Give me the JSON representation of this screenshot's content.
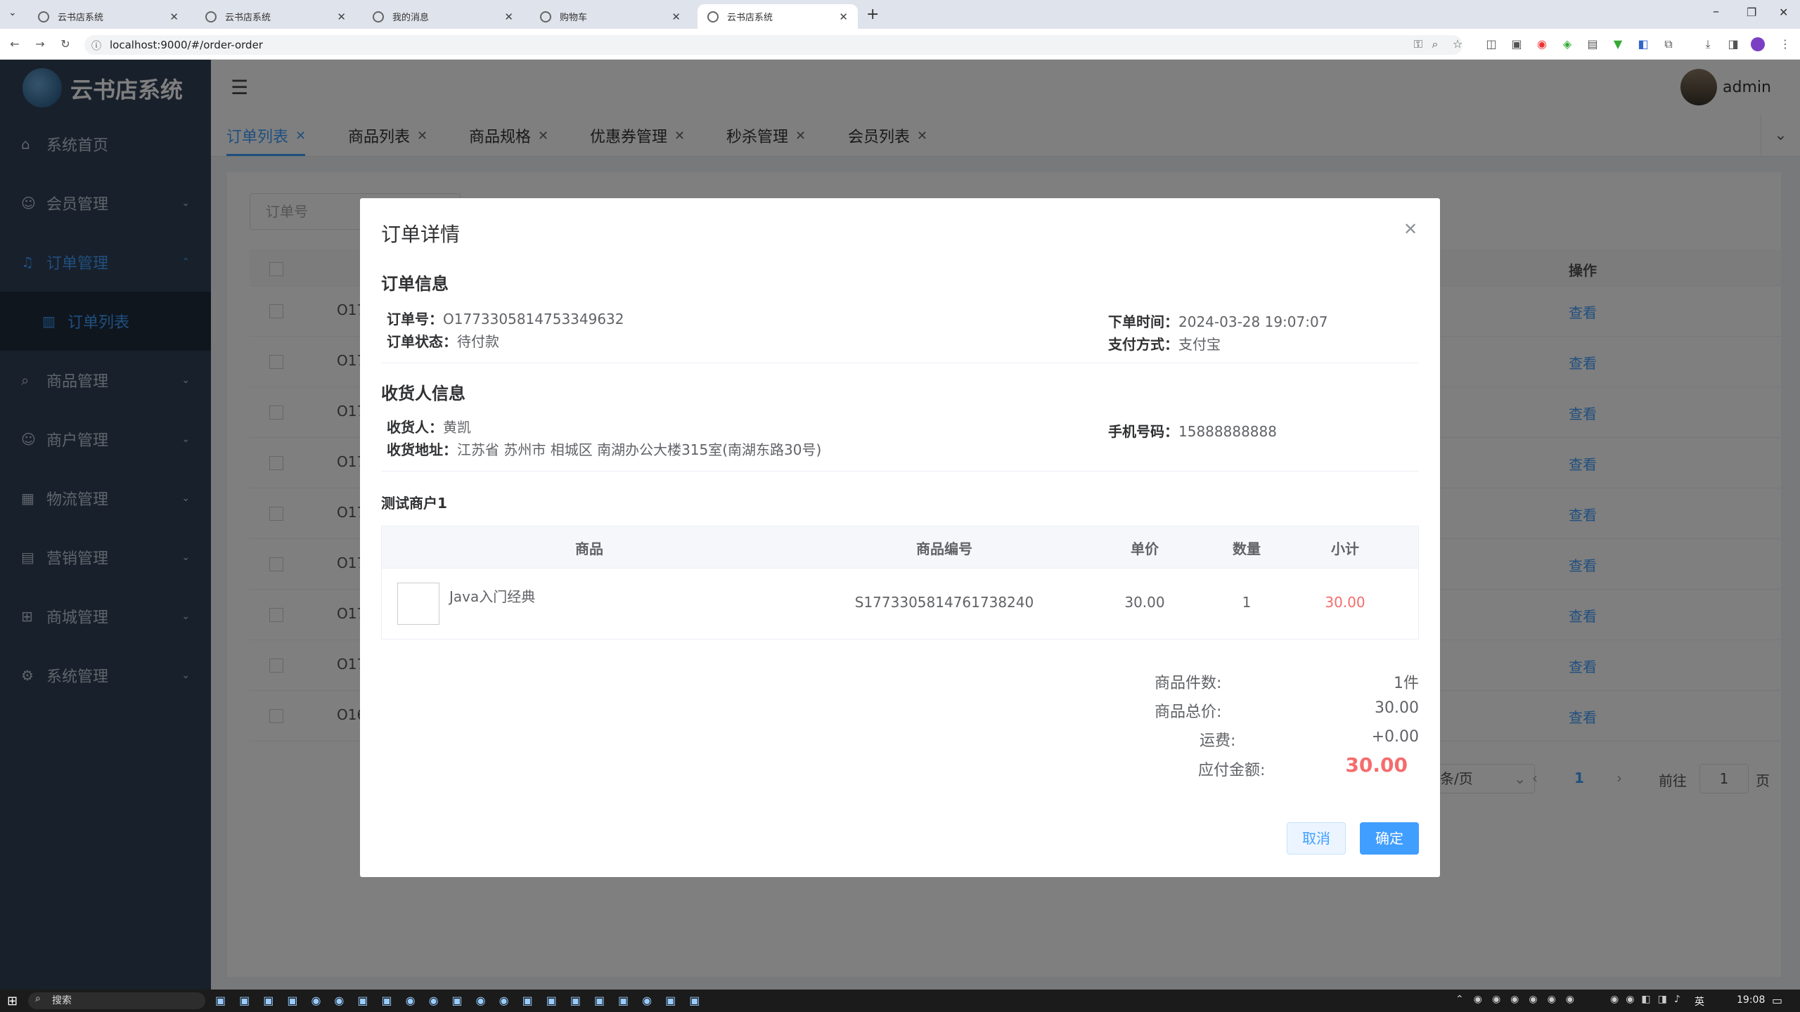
{
  "browser": {
    "tabs": [
      "云书店系统",
      "云书店系统",
      "我的消息",
      "购物车",
      "云书店系统"
    ],
    "url": "localhost:9000/#/order-order"
  },
  "app": {
    "logo": "云书店系统",
    "user": "admin",
    "menu": [
      "系统首页",
      "会员管理",
      "订单管理",
      "订单列表",
      "商品管理",
      "商户管理",
      "物流管理",
      "营销管理",
      "商城管理",
      "系统管理"
    ],
    "page_tabs": [
      "订单列表",
      "商品列表",
      "商品规格",
      "优惠券管理",
      "秒杀管理",
      "会员列表"
    ],
    "filter_placeholder": "订单号",
    "op_header": "操作",
    "row_prefixes": [
      "O17",
      "O17",
      "O17",
      "O17",
      "O17",
      "O17",
      "O17",
      "O17",
      "O16"
    ],
    "view_label": "查看",
    "pagination": {
      "size": "条/页",
      "page": "1",
      "goto": "前往",
      "goto_value": "1",
      "unit": "页"
    }
  },
  "dialog": {
    "title": "订单详情",
    "order_section": "订单信息",
    "order_no_label": "订单号：",
    "order_no": "O1773305814753349632",
    "order_time_label": "下单时间：",
    "order_time": "2024-03-28 19:07:07",
    "status_label": "订单状态：",
    "status": "待付款",
    "pay_label": "支付方式：",
    "pay": "支付宝",
    "receiver_section": "收货人信息",
    "receiver_label": "收货人：",
    "receiver": "黄凯",
    "phone_label": "手机号码：",
    "phone": "15888888888",
    "address_label": "收货地址：",
    "address": "江苏省 苏州市 相城区 南湖办公大楼315室(南湖东路30号)",
    "merchant": "测试商户1",
    "table_headers": [
      "商品",
      "商品编号",
      "单价",
      "数量",
      "小计"
    ],
    "item": {
      "name": "Java入门经典",
      "code": "S1773305814761738240",
      "price": "30.00",
      "qty": "1",
      "subtotal": "30.00"
    },
    "summary": [
      {
        "label": "商品件数:",
        "value": "1件"
      },
      {
        "label": "商品总价:",
        "value": "30.00"
      },
      {
        "label": "运费:",
        "value": "+0.00"
      }
    ],
    "payable_label": "应付金额:",
    "payable": "30.00",
    "cancel": "取消",
    "confirm": "确定"
  },
  "taskbar": {
    "search": "搜索",
    "time": "19:08",
    "lang": "英"
  },
  "colors": {
    "accent": "#409eff",
    "sidebar": "#304156",
    "price_red": "#f56c6c"
  }
}
